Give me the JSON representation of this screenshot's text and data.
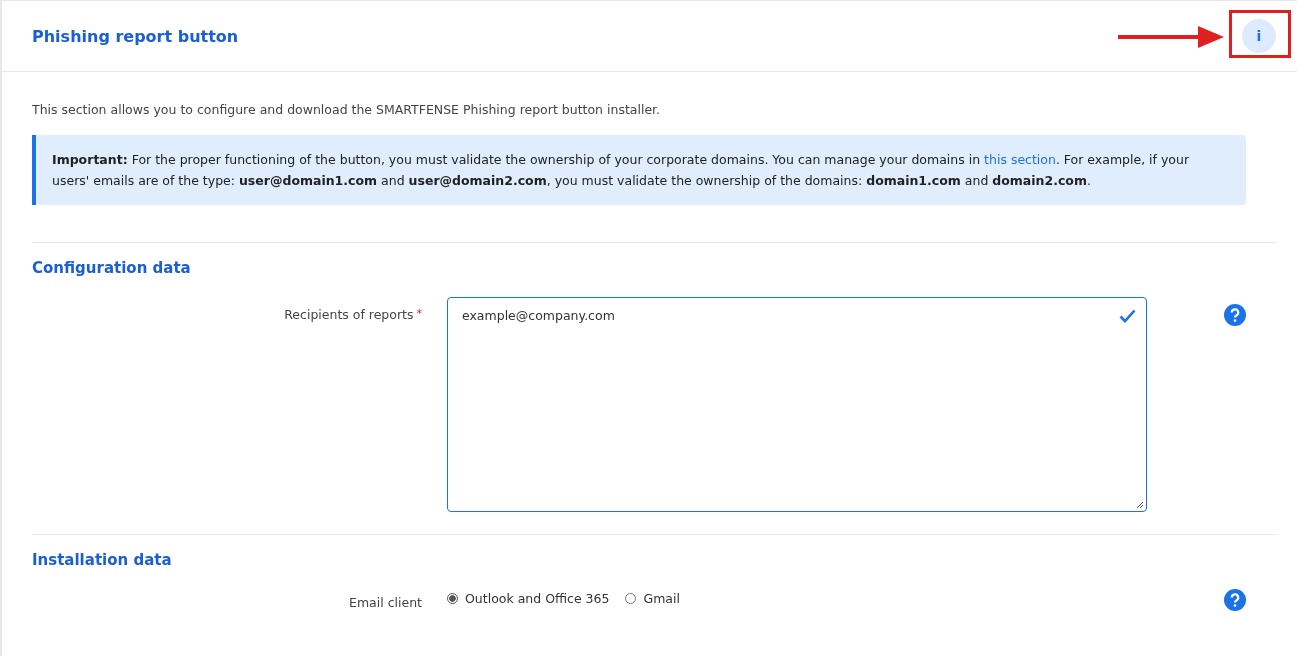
{
  "header": {
    "title": "Phishing report button",
    "info_icon": "i"
  },
  "intro": "This section allows you to configure and download the SMARTFENSE Phishing report button installer.",
  "notice": {
    "before": "**Important:** For the proper functioning of the button, you must validate the ownership of your corporate domains. You can manage your domains in ",
    "link": "this section",
    "after": ". For example, if your users' emails are of the type: **user@domain1.com** and **user@domain2.com**, you must validate the ownership of the domains: **domain1.com** and **domain2.com**."
  },
  "sections": [
    {
      "title": "Configuration data",
      "fields": [
        {
          "kind": "textarea",
          "label": "Recipients of reports",
          "required_mark": "*",
          "value": "example@company.com",
          "valid": true
        }
      ]
    },
    {
      "title": "Installation data",
      "fields": [
        {
          "kind": "radio",
          "label": "Email client",
          "options": [
            {
              "label": "Outlook and Office 365",
              "selected": true
            },
            {
              "label": "Gmail",
              "selected": false
            }
          ]
        }
      ]
    }
  ]
}
